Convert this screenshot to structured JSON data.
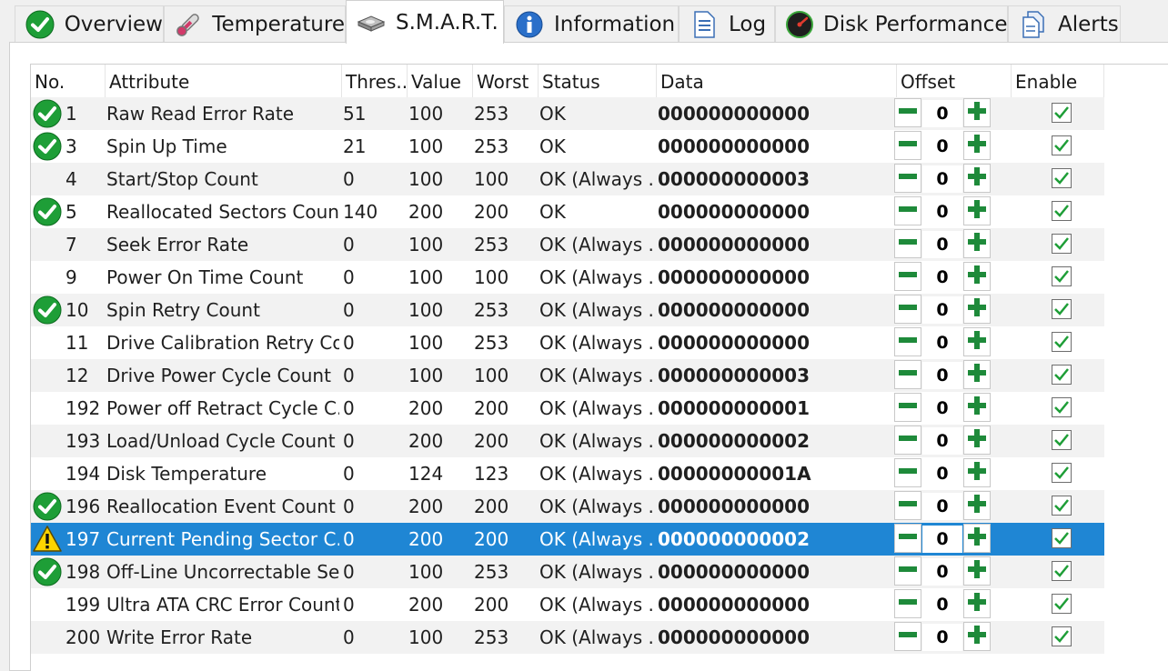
{
  "tabs": [
    {
      "label": "Overview",
      "icon": "ok-check-icon"
    },
    {
      "label": "Temperature",
      "icon": "thermometer-icon"
    },
    {
      "label": "S.M.A.R.T.",
      "icon": "disk-drive-icon",
      "active": true
    },
    {
      "label": "Information",
      "icon": "information-icon"
    },
    {
      "label": "Log",
      "icon": "log-icon"
    },
    {
      "label": "Disk Performance",
      "icon": "speedometer-icon"
    },
    {
      "label": "Alerts",
      "icon": "alerts-icon"
    }
  ],
  "columns": {
    "no": "No.",
    "attribute": "Attribute",
    "threshold": "Thres...",
    "value": "Value",
    "worst": "Worst",
    "status": "Status",
    "data": "Data",
    "offset": "Offset",
    "enable": "Enable"
  },
  "colors": {
    "selection": "#1f86d4",
    "ok_green": "#1e9e37",
    "warning_yellow": "#ffd400"
  },
  "rows": [
    {
      "no": "1",
      "attribute": "Raw Read Error Rate",
      "threshold": "51",
      "value": "100",
      "worst": "253",
      "status": "OK",
      "data": "000000000000",
      "offset": "0",
      "icon": "ok-check-icon",
      "enabled": true
    },
    {
      "no": "3",
      "attribute": "Spin Up Time",
      "threshold": "21",
      "value": "100",
      "worst": "253",
      "status": "OK",
      "data": "000000000000",
      "offset": "0",
      "icon": "ok-check-icon",
      "enabled": true
    },
    {
      "no": "4",
      "attribute": "Start/Stop Count",
      "threshold": "0",
      "value": "100",
      "worst": "100",
      "status": "OK (Always ...",
      "data": "000000000003",
      "offset": "0",
      "icon": "",
      "enabled": true
    },
    {
      "no": "5",
      "attribute": "Reallocated Sectors Count",
      "threshold": "140",
      "value": "200",
      "worst": "200",
      "status": "OK",
      "data": "000000000000",
      "offset": "0",
      "icon": "ok-check-icon",
      "enabled": true
    },
    {
      "no": "7",
      "attribute": "Seek Error Rate",
      "threshold": "0",
      "value": "100",
      "worst": "253",
      "status": "OK (Always ...",
      "data": "000000000000",
      "offset": "0",
      "icon": "",
      "enabled": true
    },
    {
      "no": "9",
      "attribute": "Power On Time Count",
      "threshold": "0",
      "value": "100",
      "worst": "100",
      "status": "OK (Always ...",
      "data": "000000000000",
      "offset": "0",
      "icon": "",
      "enabled": true
    },
    {
      "no": "10",
      "attribute": "Spin Retry Count",
      "threshold": "0",
      "value": "100",
      "worst": "253",
      "status": "OK (Always ...",
      "data": "000000000000",
      "offset": "0",
      "icon": "ok-check-icon",
      "enabled": true
    },
    {
      "no": "11",
      "attribute": "Drive Calibration Retry Co...",
      "threshold": "0",
      "value": "100",
      "worst": "253",
      "status": "OK (Always ...",
      "data": "000000000000",
      "offset": "0",
      "icon": "",
      "enabled": true
    },
    {
      "no": "12",
      "attribute": "Drive Power Cycle Count",
      "threshold": "0",
      "value": "100",
      "worst": "100",
      "status": "OK (Always ...",
      "data": "000000000003",
      "offset": "0",
      "icon": "",
      "enabled": true
    },
    {
      "no": "192",
      "attribute": "Power off Retract Cycle C...",
      "threshold": "0",
      "value": "200",
      "worst": "200",
      "status": "OK (Always ...",
      "data": "000000000001",
      "offset": "0",
      "icon": "",
      "enabled": true
    },
    {
      "no": "193",
      "attribute": "Load/Unload Cycle Count",
      "threshold": "0",
      "value": "200",
      "worst": "200",
      "status": "OK (Always ...",
      "data": "000000000002",
      "offset": "0",
      "icon": "",
      "enabled": true
    },
    {
      "no": "194",
      "attribute": "Disk Temperature",
      "threshold": "0",
      "value": "124",
      "worst": "123",
      "status": "OK (Always ...",
      "data": "00000000001A",
      "offset": "0",
      "icon": "",
      "enabled": true
    },
    {
      "no": "196",
      "attribute": "Reallocation Event Count",
      "threshold": "0",
      "value": "200",
      "worst": "200",
      "status": "OK (Always ...",
      "data": "000000000000",
      "offset": "0",
      "icon": "ok-check-icon",
      "enabled": true
    },
    {
      "no": "197",
      "attribute": "Current Pending Sector C...",
      "threshold": "0",
      "value": "200",
      "worst": "200",
      "status": "OK (Always ...",
      "data": "000000000002",
      "offset": "0",
      "icon": "warning-icon",
      "enabled": true,
      "selected": true
    },
    {
      "no": "198",
      "attribute": "Off-Line Uncorrectable Se...",
      "threshold": "0",
      "value": "100",
      "worst": "253",
      "status": "OK (Always ...",
      "data": "000000000000",
      "offset": "0",
      "icon": "ok-check-icon",
      "enabled": true
    },
    {
      "no": "199",
      "attribute": "Ultra ATA CRC Error Count",
      "threshold": "0",
      "value": "200",
      "worst": "200",
      "status": "OK (Always ...",
      "data": "000000000000",
      "offset": "0",
      "icon": "",
      "enabled": true
    },
    {
      "no": "200",
      "attribute": "Write Error Rate",
      "threshold": "0",
      "value": "100",
      "worst": "253",
      "status": "OK (Always ...",
      "data": "000000000000",
      "offset": "0",
      "icon": "",
      "enabled": true
    }
  ]
}
